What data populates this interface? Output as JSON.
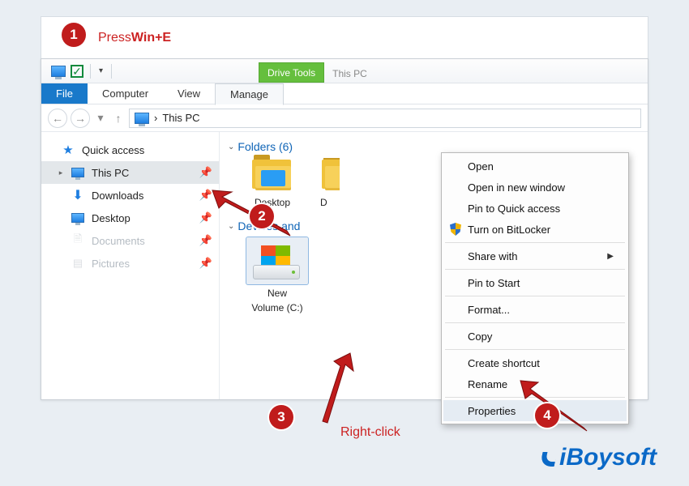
{
  "annotations": {
    "step1_prefix": "Press ",
    "step1_key": "Win+E",
    "step3_label": "Right-click",
    "badge1": "1",
    "badge2": "2",
    "badge3": "3",
    "badge4": "4"
  },
  "titlebar": {
    "drive_tools": "Drive Tools",
    "this_pc_tab": "This PC"
  },
  "ribbon": {
    "file": "File",
    "computer": "Computer",
    "view": "View",
    "manage": "Manage"
  },
  "breadcrumb": {
    "location": "This PC",
    "sep": "›"
  },
  "sidebar": {
    "quick_access": "Quick access",
    "this_pc": "This PC",
    "downloads": "Downloads",
    "desktop": "Desktop",
    "documents": "Documents",
    "pictures": "Pictures"
  },
  "content": {
    "folders_header": "Folders (6)",
    "devices_header": "Devices and ",
    "folder_desktop": "Desktop",
    "folder_d_initial": "D",
    "drive_line1": "New",
    "drive_line2": "Volume (C:)"
  },
  "context_menu": {
    "open": "Open",
    "open_new": "Open in new window",
    "pin_quick": "Pin to Quick access",
    "bitlocker": "Turn on BitLocker",
    "share_with": "Share with",
    "pin_start": "Pin to Start",
    "format": "Format...",
    "copy": "Copy",
    "create_shortcut": "Create shortcut",
    "rename": "Rename",
    "properties": "Properties"
  },
  "watermark": {
    "brand": "iBoysoft"
  }
}
